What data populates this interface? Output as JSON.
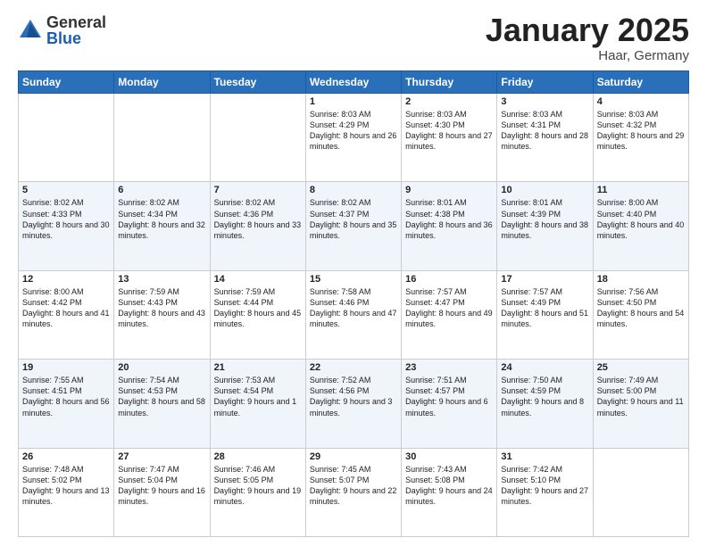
{
  "logo": {
    "general": "General",
    "blue": "Blue"
  },
  "title": {
    "month": "January 2025",
    "location": "Haar, Germany"
  },
  "weekdays": [
    "Sunday",
    "Monday",
    "Tuesday",
    "Wednesday",
    "Thursday",
    "Friday",
    "Saturday"
  ],
  "weeks": [
    [
      {
        "day": "",
        "info": ""
      },
      {
        "day": "",
        "info": ""
      },
      {
        "day": "",
        "info": ""
      },
      {
        "day": "1",
        "info": "Sunrise: 8:03 AM\nSunset: 4:29 PM\nDaylight: 8 hours and 26 minutes."
      },
      {
        "day": "2",
        "info": "Sunrise: 8:03 AM\nSunset: 4:30 PM\nDaylight: 8 hours and 27 minutes."
      },
      {
        "day": "3",
        "info": "Sunrise: 8:03 AM\nSunset: 4:31 PM\nDaylight: 8 hours and 28 minutes."
      },
      {
        "day": "4",
        "info": "Sunrise: 8:03 AM\nSunset: 4:32 PM\nDaylight: 8 hours and 29 minutes."
      }
    ],
    [
      {
        "day": "5",
        "info": "Sunrise: 8:02 AM\nSunset: 4:33 PM\nDaylight: 8 hours and 30 minutes."
      },
      {
        "day": "6",
        "info": "Sunrise: 8:02 AM\nSunset: 4:34 PM\nDaylight: 8 hours and 32 minutes."
      },
      {
        "day": "7",
        "info": "Sunrise: 8:02 AM\nSunset: 4:36 PM\nDaylight: 8 hours and 33 minutes."
      },
      {
        "day": "8",
        "info": "Sunrise: 8:02 AM\nSunset: 4:37 PM\nDaylight: 8 hours and 35 minutes."
      },
      {
        "day": "9",
        "info": "Sunrise: 8:01 AM\nSunset: 4:38 PM\nDaylight: 8 hours and 36 minutes."
      },
      {
        "day": "10",
        "info": "Sunrise: 8:01 AM\nSunset: 4:39 PM\nDaylight: 8 hours and 38 minutes."
      },
      {
        "day": "11",
        "info": "Sunrise: 8:00 AM\nSunset: 4:40 PM\nDaylight: 8 hours and 40 minutes."
      }
    ],
    [
      {
        "day": "12",
        "info": "Sunrise: 8:00 AM\nSunset: 4:42 PM\nDaylight: 8 hours and 41 minutes."
      },
      {
        "day": "13",
        "info": "Sunrise: 7:59 AM\nSunset: 4:43 PM\nDaylight: 8 hours and 43 minutes."
      },
      {
        "day": "14",
        "info": "Sunrise: 7:59 AM\nSunset: 4:44 PM\nDaylight: 8 hours and 45 minutes."
      },
      {
        "day": "15",
        "info": "Sunrise: 7:58 AM\nSunset: 4:46 PM\nDaylight: 8 hours and 47 minutes."
      },
      {
        "day": "16",
        "info": "Sunrise: 7:57 AM\nSunset: 4:47 PM\nDaylight: 8 hours and 49 minutes."
      },
      {
        "day": "17",
        "info": "Sunrise: 7:57 AM\nSunset: 4:49 PM\nDaylight: 8 hours and 51 minutes."
      },
      {
        "day": "18",
        "info": "Sunrise: 7:56 AM\nSunset: 4:50 PM\nDaylight: 8 hours and 54 minutes."
      }
    ],
    [
      {
        "day": "19",
        "info": "Sunrise: 7:55 AM\nSunset: 4:51 PM\nDaylight: 8 hours and 56 minutes."
      },
      {
        "day": "20",
        "info": "Sunrise: 7:54 AM\nSunset: 4:53 PM\nDaylight: 8 hours and 58 minutes."
      },
      {
        "day": "21",
        "info": "Sunrise: 7:53 AM\nSunset: 4:54 PM\nDaylight: 9 hours and 1 minute."
      },
      {
        "day": "22",
        "info": "Sunrise: 7:52 AM\nSunset: 4:56 PM\nDaylight: 9 hours and 3 minutes."
      },
      {
        "day": "23",
        "info": "Sunrise: 7:51 AM\nSunset: 4:57 PM\nDaylight: 9 hours and 6 minutes."
      },
      {
        "day": "24",
        "info": "Sunrise: 7:50 AM\nSunset: 4:59 PM\nDaylight: 9 hours and 8 minutes."
      },
      {
        "day": "25",
        "info": "Sunrise: 7:49 AM\nSunset: 5:00 PM\nDaylight: 9 hours and 11 minutes."
      }
    ],
    [
      {
        "day": "26",
        "info": "Sunrise: 7:48 AM\nSunset: 5:02 PM\nDaylight: 9 hours and 13 minutes."
      },
      {
        "day": "27",
        "info": "Sunrise: 7:47 AM\nSunset: 5:04 PM\nDaylight: 9 hours and 16 minutes."
      },
      {
        "day": "28",
        "info": "Sunrise: 7:46 AM\nSunset: 5:05 PM\nDaylight: 9 hours and 19 minutes."
      },
      {
        "day": "29",
        "info": "Sunrise: 7:45 AM\nSunset: 5:07 PM\nDaylight: 9 hours and 22 minutes."
      },
      {
        "day": "30",
        "info": "Sunrise: 7:43 AM\nSunset: 5:08 PM\nDaylight: 9 hours and 24 minutes."
      },
      {
        "day": "31",
        "info": "Sunrise: 7:42 AM\nSunset: 5:10 PM\nDaylight: 9 hours and 27 minutes."
      },
      {
        "day": "",
        "info": ""
      }
    ]
  ]
}
